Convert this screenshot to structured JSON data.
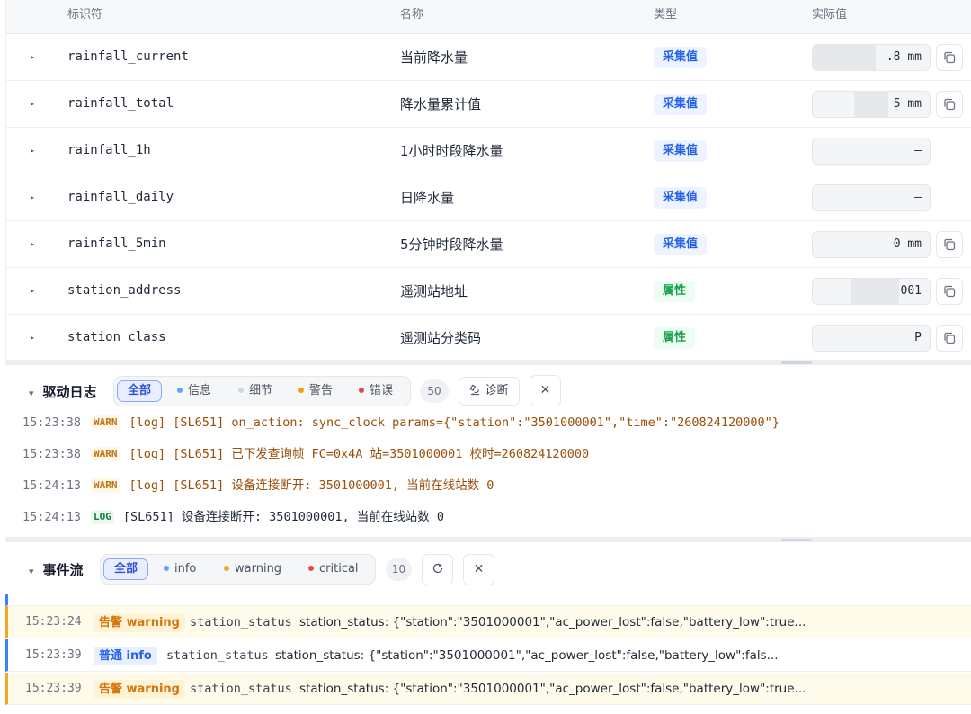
{
  "table": {
    "headers": {
      "id": "标识符",
      "name": "名称",
      "type": "类型",
      "value": "实际值"
    },
    "rows": [
      {
        "id": "rainfall_current",
        "name": "当前降水量",
        "type": "采集值",
        "kind": "collect",
        "value": ".8 mm",
        "copy": true
      },
      {
        "id": "rainfall_total",
        "name": "降水量累计值",
        "type": "采集值",
        "kind": "collect",
        "value": "5 mm",
        "copy": true
      },
      {
        "id": "rainfall_1h",
        "name": "1小时时段降水量",
        "type": "采集值",
        "kind": "collect",
        "value": "—",
        "copy": false
      },
      {
        "id": "rainfall_daily",
        "name": "日降水量",
        "type": "采集值",
        "kind": "collect",
        "value": "—",
        "copy": false
      },
      {
        "id": "rainfall_5min",
        "name": "5分钟时段降水量",
        "type": "采集值",
        "kind": "collect",
        "value": "0 mm",
        "copy": true
      },
      {
        "id": "station_address",
        "name": "遥测站地址",
        "type": "属性",
        "kind": "prop",
        "value": "001",
        "copy": true
      },
      {
        "id": "station_class",
        "name": "遥测站分类码",
        "type": "属性",
        "kind": "prop",
        "value": "P",
        "copy": true
      }
    ]
  },
  "driver_log": {
    "title": "驱动日志",
    "filters": [
      {
        "label": "全部",
        "active": true,
        "color": ""
      },
      {
        "label": "信息",
        "active": false,
        "color": "#60a5fa"
      },
      {
        "label": "细节",
        "active": false,
        "color": "#d1d5db"
      },
      {
        "label": "警告",
        "active": false,
        "color": "#f59e0b"
      },
      {
        "label": "错误",
        "active": false,
        "color": "#ef4444"
      }
    ],
    "count": "50",
    "diagnose_label": "诊断",
    "lines": [
      {
        "time": "15:23:38",
        "level": "WARN",
        "kind": "warn",
        "message": "[log] [SL651] on_action: sync_clock params={\"station\":\"3501000001\",\"time\":\"260824120000\"}"
      },
      {
        "time": "15:23:38",
        "level": "WARN",
        "kind": "warn",
        "message": "[log] [SL651] 已下发查询帧 FC=0x4A 站=3501000001 校时=260824120000"
      },
      {
        "time": "15:24:13",
        "level": "WARN",
        "kind": "warn",
        "message": "[log] [SL651] 设备连接断开: 3501000001, 当前在线站数 0"
      },
      {
        "time": "15:24:13",
        "level": "LOG",
        "kind": "log",
        "message": "[SL651] 设备连接断开: 3501000001, 当前在线站数 0"
      }
    ]
  },
  "event_stream": {
    "title": "事件流",
    "filters": [
      {
        "label": "全部",
        "active": true,
        "color": ""
      },
      {
        "label": "info",
        "active": false,
        "color": "#60a5fa"
      },
      {
        "label": "warning",
        "active": false,
        "color": "#f5a623"
      },
      {
        "label": "critical",
        "active": false,
        "color": "#ef4444"
      }
    ],
    "count": "10",
    "rows": [
      {
        "time": "15:23:24",
        "badge": "告警 warning",
        "kind": "warning",
        "type": "station_status",
        "message": "station_status: {\"station\":\"3501000001\",\"ac_power_lost\":false,\"battery_low\":true..."
      },
      {
        "time": "15:23:39",
        "badge": "普通 info",
        "kind": "info",
        "type": "station_status",
        "message": "station_status: {\"station\":\"3501000001\",\"ac_power_lost\":false,\"battery_low\":fals..."
      },
      {
        "time": "15:23:39",
        "badge": "告警 warning",
        "kind": "warning",
        "type": "station_status",
        "message": "station_status: {\"station\":\"3501000001\",\"ac_power_lost\":false,\"battery_low\":true..."
      }
    ]
  }
}
